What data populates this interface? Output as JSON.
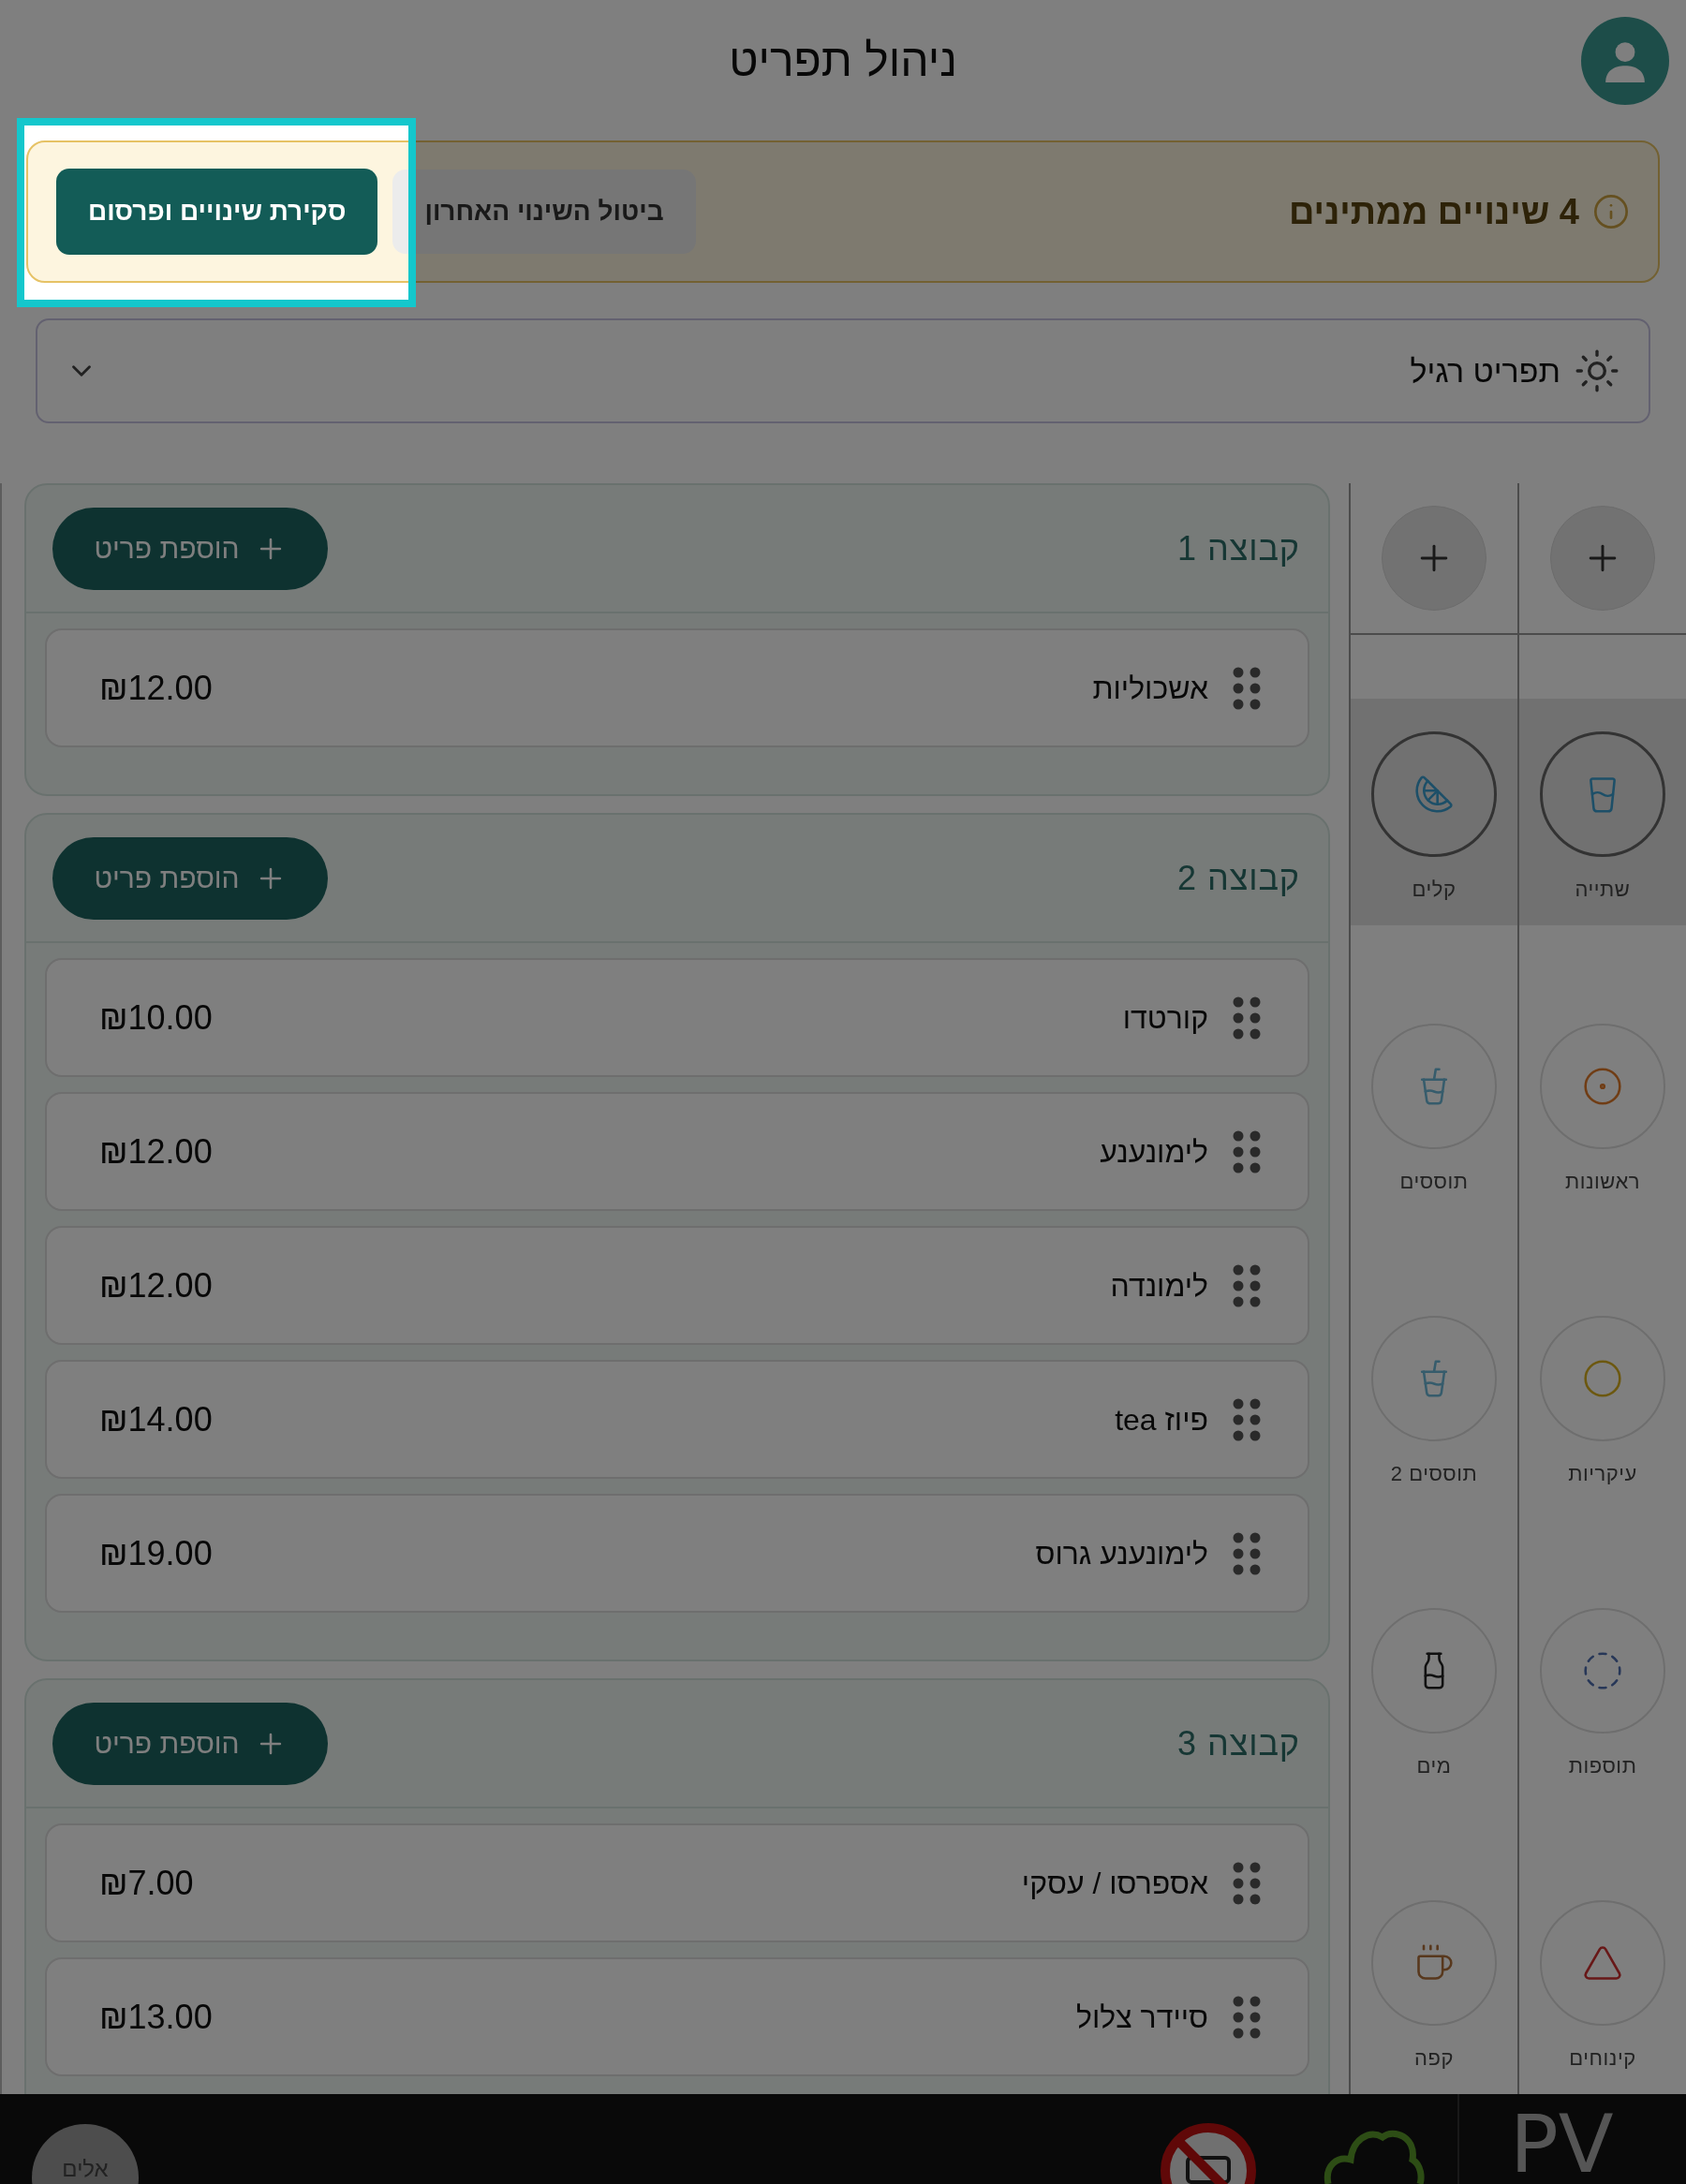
{
  "header": {
    "title": "ניהול תפריט"
  },
  "pending_banner": {
    "message": "4 שינויים ממתינים",
    "undo_button": "ביטול השינוי האחרון",
    "publish_button": "סקירת שינויים ופרסום",
    "highlighted": true
  },
  "menu_select": {
    "value": "תפריט רגיל"
  },
  "groups": [
    {
      "title": "קבוצה 1",
      "add_button": "הוספת פריט",
      "items": [
        {
          "name": "אשכוליות",
          "price": "₪12.00"
        }
      ]
    },
    {
      "title": "קבוצה 2",
      "add_button": "הוספת פריט",
      "items": [
        {
          "name": "קורטדו",
          "price": "₪10.00"
        },
        {
          "name": "לימונענע",
          "price": "₪12.00"
        },
        {
          "name": "לימונדה",
          "price": "₪12.00"
        },
        {
          "name": "פיוז tea",
          "price": "₪14.00"
        },
        {
          "name": "לימונענע גרוס",
          "price": "₪19.00"
        }
      ]
    },
    {
      "title": "קבוצה 3",
      "add_button": "הוספת פריט",
      "items": [
        {
          "name": "אספרסו / עסקי",
          "price": "₪7.00"
        },
        {
          "name": "סיידר צלול",
          "price": "₪13.00"
        }
      ]
    }
  ],
  "category_columns": [
    {
      "items": [
        {
          "label": "שתייה",
          "selected": true
        },
        {
          "label": "ראשונות",
          "selected": false
        },
        {
          "label": "עיקריות",
          "selected": false
        },
        {
          "label": "תוספות",
          "selected": false
        },
        {
          "label": "קינוחים",
          "selected": false
        }
      ]
    },
    {
      "items": [
        {
          "label": "קלים",
          "selected": true
        },
        {
          "label": "תוססים",
          "selected": false
        },
        {
          "label": "תוססים 2",
          "selected": false
        },
        {
          "label": "מים",
          "selected": false
        },
        {
          "label": "קפה",
          "selected": false
        }
      ]
    }
  ],
  "bottom_bar": {
    "user_label": "אלים",
    "brand": "PV"
  }
}
